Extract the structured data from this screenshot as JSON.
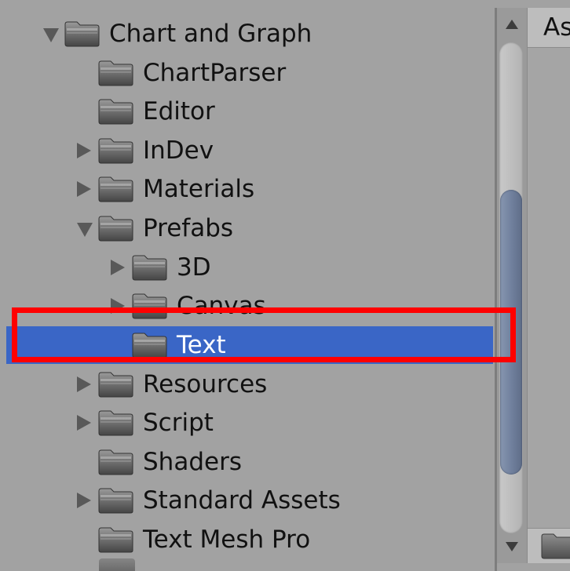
{
  "tree": {
    "items": [
      {
        "label": "Chart and Graph",
        "expander": "expanded"
      },
      {
        "label": "ChartParser",
        "expander": "none"
      },
      {
        "label": "Editor",
        "expander": "none"
      },
      {
        "label": "InDev",
        "expander": "collapsed"
      },
      {
        "label": "Materials",
        "expander": "collapsed"
      },
      {
        "label": "Prefabs",
        "expander": "expanded"
      },
      {
        "label": "3D",
        "expander": "collapsed"
      },
      {
        "label": "Canvas",
        "expander": "collapsed"
      },
      {
        "label": "Text",
        "expander": "none",
        "selected": true
      },
      {
        "label": "Resources",
        "expander": "collapsed"
      },
      {
        "label": "Script",
        "expander": "collapsed"
      },
      {
        "label": "Shaders",
        "expander": "none"
      },
      {
        "label": "Standard Assets",
        "expander": "collapsed"
      },
      {
        "label": "Text Mesh Pro",
        "expander": "none"
      }
    ]
  },
  "right_panel": {
    "header_label": "As"
  },
  "scrollbar": {
    "thumb_fraction_start": 0.3,
    "thumb_fraction_end": 0.88
  },
  "colors": {
    "selection": "#3a66c6",
    "highlight_box": "#ff0000",
    "panel_background": "#a2a2a2"
  },
  "icons": {
    "folder": "folder-icon",
    "expanded": "triangle-down-icon",
    "collapsed": "triangle-right-icon"
  }
}
